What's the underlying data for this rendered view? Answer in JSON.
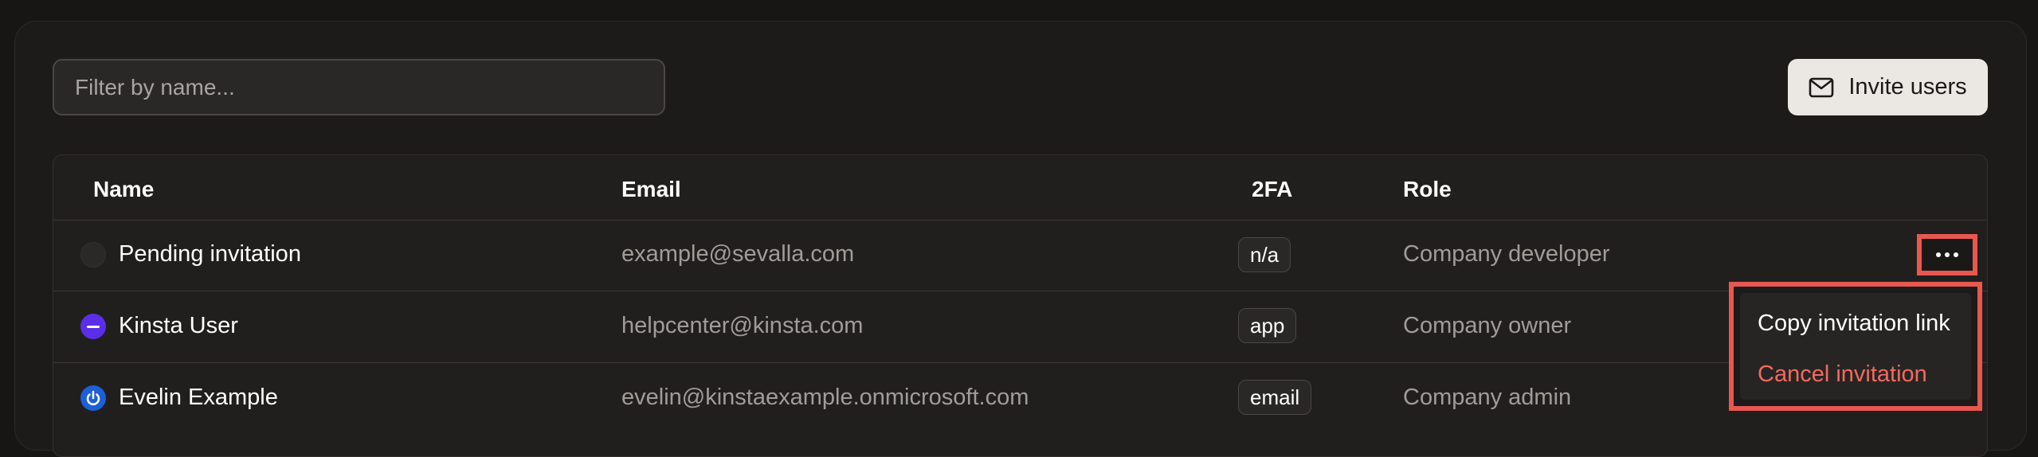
{
  "filter": {
    "placeholder": "Filter by name..."
  },
  "invite_button": {
    "label": "Invite users",
    "icon": "mail-icon"
  },
  "table": {
    "headers": {
      "name": "Name",
      "email": "Email",
      "twofa": "2FA",
      "role": "Role"
    },
    "rows": [
      {
        "name": "Pending invitation",
        "email": "example@sevalla.com",
        "twofa": "n/a",
        "role": "Company developer",
        "avatar": "pending-avatar"
      },
      {
        "name": "Kinsta User",
        "email": "helpcenter@kinsta.com",
        "twofa": "app",
        "role": "Company owner",
        "avatar": "kinsta-avatar"
      },
      {
        "name": "Evelin Example",
        "email": "evelin@kinstaexample.onmicrosoft.com",
        "twofa": "email",
        "role": "Company admin",
        "avatar": "power-avatar"
      }
    ]
  },
  "row_menu": {
    "more_icon": "more-horizontal-icon",
    "items": [
      {
        "label": "Copy invitation link"
      },
      {
        "label": "Cancel invitation"
      }
    ]
  },
  "colors": {
    "accent_highlight": "#e8584f",
    "danger_text": "#f26a5f",
    "kinsta_purple": "#5b2ee8",
    "microsoft_blue": "#1c5fd6"
  }
}
